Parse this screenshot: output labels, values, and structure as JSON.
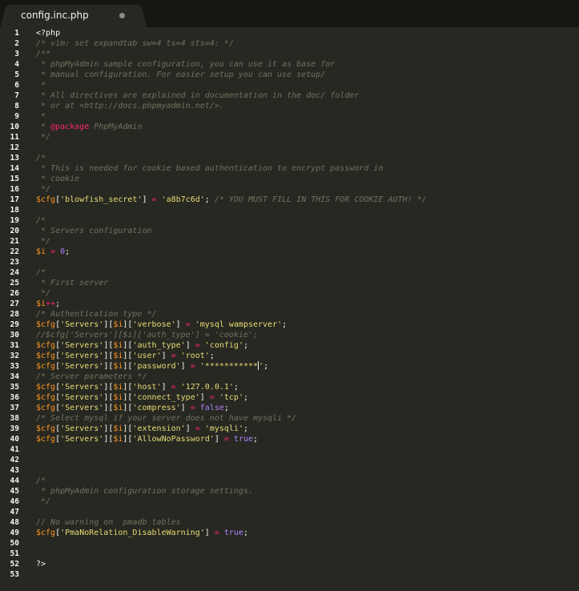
{
  "tab": {
    "title": "config.inc.php"
  },
  "colors": {
    "background": "#272822",
    "comment": "#75715e",
    "string": "#e6db74",
    "variable": "#fd971f",
    "number": "#ae81ff",
    "operator": "#f92672"
  },
  "lines": [
    {
      "n": "1",
      "t": [
        [
          "p",
          "<?php"
        ]
      ]
    },
    {
      "n": "2",
      "t": [
        [
          "c",
          "/* vim: set expandtab sw=4 ts=4 sts=4: */"
        ]
      ]
    },
    {
      "n": "3",
      "t": [
        [
          "c",
          "/**"
        ]
      ]
    },
    {
      "n": "4",
      "t": [
        [
          "c",
          " * phpMyAdmin sample configuration, you can use it as base for"
        ]
      ]
    },
    {
      "n": "5",
      "t": [
        [
          "c",
          " * manual configuration. For easier setup you can use setup/"
        ]
      ]
    },
    {
      "n": "6",
      "t": [
        [
          "c",
          " *"
        ]
      ]
    },
    {
      "n": "7",
      "t": [
        [
          "c",
          " * All directives are explained in documentation in the doc/ folder"
        ]
      ]
    },
    {
      "n": "8",
      "t": [
        [
          "c",
          " * or at <http://docs.phpmyadmin.net/>."
        ]
      ]
    },
    {
      "n": "9",
      "t": [
        [
          "c",
          " *"
        ]
      ]
    },
    {
      "n": "10",
      "t": [
        [
          "c",
          " * "
        ],
        [
          "tg",
          "@package"
        ],
        [
          "c",
          " PhpMyAdmin"
        ]
      ]
    },
    {
      "n": "11",
      "t": [
        [
          "c",
          " */"
        ]
      ]
    },
    {
      "n": "12",
      "t": []
    },
    {
      "n": "13",
      "t": [
        [
          "c",
          "/*"
        ]
      ]
    },
    {
      "n": "14",
      "t": [
        [
          "c",
          " * This is needed for cookie based authentication to encrypt password in"
        ]
      ]
    },
    {
      "n": "15",
      "t": [
        [
          "c",
          " * cookie"
        ]
      ]
    },
    {
      "n": "16",
      "t": [
        [
          "c",
          " */"
        ]
      ]
    },
    {
      "n": "17",
      "t": [
        [
          "v",
          "$cfg"
        ],
        [
          "p",
          "["
        ],
        [
          "s",
          "'blowfish_secret'"
        ],
        [
          "p",
          "] "
        ],
        [
          "o",
          "="
        ],
        [
          "p",
          " "
        ],
        [
          "s",
          "'a8b7c6d'"
        ],
        [
          "p",
          "; "
        ],
        [
          "c",
          "/* YOU MUST FILL IN THIS FOR COOKIE AUTH! */"
        ]
      ]
    },
    {
      "n": "18",
      "t": []
    },
    {
      "n": "19",
      "t": [
        [
          "c",
          "/*"
        ]
      ]
    },
    {
      "n": "20",
      "t": [
        [
          "c",
          " * Servers configuration"
        ]
      ]
    },
    {
      "n": "21",
      "t": [
        [
          "c",
          " */"
        ]
      ]
    },
    {
      "n": "22",
      "t": [
        [
          "v",
          "$i"
        ],
        [
          "p",
          " "
        ],
        [
          "o",
          "="
        ],
        [
          "p",
          " "
        ],
        [
          "n",
          "0"
        ],
        [
          "p",
          ";"
        ]
      ]
    },
    {
      "n": "23",
      "t": []
    },
    {
      "n": "24",
      "t": [
        [
          "c",
          "/*"
        ]
      ]
    },
    {
      "n": "25",
      "t": [
        [
          "c",
          " * First server"
        ]
      ]
    },
    {
      "n": "26",
      "t": [
        [
          "c",
          " */"
        ]
      ]
    },
    {
      "n": "27",
      "t": [
        [
          "v",
          "$i"
        ],
        [
          "o",
          "++"
        ],
        [
          "p",
          ";"
        ]
      ]
    },
    {
      "n": "28",
      "t": [
        [
          "c",
          "/* Authentication type */"
        ]
      ]
    },
    {
      "n": "29",
      "t": [
        [
          "v",
          "$cfg"
        ],
        [
          "p",
          "["
        ],
        [
          "s",
          "'Servers'"
        ],
        [
          "p",
          "]["
        ],
        [
          "v",
          "$i"
        ],
        [
          "p",
          "]["
        ],
        [
          "s",
          "'verbose'"
        ],
        [
          "p",
          "] "
        ],
        [
          "o",
          "="
        ],
        [
          "p",
          " "
        ],
        [
          "s",
          "'mysql wampserver'"
        ],
        [
          "p",
          ";"
        ]
      ]
    },
    {
      "n": "30",
      "t": [
        [
          "c",
          "//$cfg['Servers'][$i]['auth_type'] = 'cookie';"
        ]
      ]
    },
    {
      "n": "31",
      "t": [
        [
          "v",
          "$cfg"
        ],
        [
          "p",
          "["
        ],
        [
          "s",
          "'Servers'"
        ],
        [
          "p",
          "]["
        ],
        [
          "v",
          "$i"
        ],
        [
          "p",
          "]["
        ],
        [
          "s",
          "'auth_type'"
        ],
        [
          "p",
          "] "
        ],
        [
          "o",
          "="
        ],
        [
          "p",
          " "
        ],
        [
          "s",
          "'config'"
        ],
        [
          "p",
          ";"
        ]
      ]
    },
    {
      "n": "32",
      "t": [
        [
          "v",
          "$cfg"
        ],
        [
          "p",
          "["
        ],
        [
          "s",
          "'Servers'"
        ],
        [
          "p",
          "]["
        ],
        [
          "v",
          "$i"
        ],
        [
          "p",
          "]["
        ],
        [
          "s",
          "'user'"
        ],
        [
          "p",
          "] "
        ],
        [
          "o",
          "="
        ],
        [
          "p",
          " "
        ],
        [
          "s",
          "'root'"
        ],
        [
          "p",
          ";"
        ]
      ]
    },
    {
      "n": "33",
      "t": [
        [
          "v",
          "$cfg"
        ],
        [
          "p",
          "["
        ],
        [
          "s",
          "'Servers'"
        ],
        [
          "p",
          "]["
        ],
        [
          "v",
          "$i"
        ],
        [
          "p",
          "]["
        ],
        [
          "s",
          "'password'"
        ],
        [
          "p",
          "] "
        ],
        [
          "o",
          "="
        ],
        [
          "p",
          " "
        ],
        [
          "s",
          "'***********"
        ],
        [
          "caret",
          ""
        ],
        [
          "s",
          "'"
        ],
        [
          "p",
          ";"
        ]
      ]
    },
    {
      "n": "34",
      "t": [
        [
          "c",
          "/* Server parameters */"
        ]
      ]
    },
    {
      "n": "35",
      "t": [
        [
          "v",
          "$cfg"
        ],
        [
          "p",
          "["
        ],
        [
          "s",
          "'Servers'"
        ],
        [
          "p",
          "]["
        ],
        [
          "v",
          "$i"
        ],
        [
          "p",
          "]["
        ],
        [
          "s",
          "'host'"
        ],
        [
          "p",
          "] "
        ],
        [
          "o",
          "="
        ],
        [
          "p",
          " "
        ],
        [
          "s",
          "'127.0.0.1'"
        ],
        [
          "p",
          ";"
        ]
      ]
    },
    {
      "n": "36",
      "t": [
        [
          "v",
          "$cfg"
        ],
        [
          "p",
          "["
        ],
        [
          "s",
          "'Servers'"
        ],
        [
          "p",
          "]["
        ],
        [
          "v",
          "$i"
        ],
        [
          "p",
          "]["
        ],
        [
          "s",
          "'connect_type'"
        ],
        [
          "p",
          "] "
        ],
        [
          "o",
          "="
        ],
        [
          "p",
          " "
        ],
        [
          "s",
          "'tcp'"
        ],
        [
          "p",
          ";"
        ]
      ]
    },
    {
      "n": "37",
      "t": [
        [
          "v",
          "$cfg"
        ],
        [
          "p",
          "["
        ],
        [
          "s",
          "'Servers'"
        ],
        [
          "p",
          "]["
        ],
        [
          "v",
          "$i"
        ],
        [
          "p",
          "]["
        ],
        [
          "s",
          "'compress'"
        ],
        [
          "p",
          "] "
        ],
        [
          "o",
          "="
        ],
        [
          "p",
          " "
        ],
        [
          "k",
          "false"
        ],
        [
          "p",
          ";"
        ]
      ]
    },
    {
      "n": "38",
      "t": [
        [
          "c",
          "/* Select mysql if your server does not have mysqli */"
        ]
      ]
    },
    {
      "n": "39",
      "t": [
        [
          "v",
          "$cfg"
        ],
        [
          "p",
          "["
        ],
        [
          "s",
          "'Servers'"
        ],
        [
          "p",
          "]["
        ],
        [
          "v",
          "$i"
        ],
        [
          "p",
          "]["
        ],
        [
          "s",
          "'extension'"
        ],
        [
          "p",
          "] "
        ],
        [
          "o",
          "="
        ],
        [
          "p",
          " "
        ],
        [
          "s",
          "'mysqli'"
        ],
        [
          "p",
          ";"
        ]
      ]
    },
    {
      "n": "40",
      "t": [
        [
          "v",
          "$cfg"
        ],
        [
          "p",
          "["
        ],
        [
          "s",
          "'Servers'"
        ],
        [
          "p",
          "]["
        ],
        [
          "v",
          "$i"
        ],
        [
          "p",
          "]["
        ],
        [
          "s",
          "'AllowNoPassword'"
        ],
        [
          "p",
          "] "
        ],
        [
          "o",
          "="
        ],
        [
          "p",
          " "
        ],
        [
          "k",
          "true"
        ],
        [
          "p",
          ";"
        ]
      ]
    },
    {
      "n": "41",
      "t": []
    },
    {
      "n": "42",
      "t": []
    },
    {
      "n": "43",
      "t": []
    },
    {
      "n": "44",
      "t": [
        [
          "c",
          "/*"
        ]
      ]
    },
    {
      "n": "45",
      "t": [
        [
          "c",
          " * phpMyAdmin configuration storage settings."
        ]
      ]
    },
    {
      "n": "46",
      "t": [
        [
          "c",
          " */"
        ]
      ]
    },
    {
      "n": "47",
      "t": []
    },
    {
      "n": "48",
      "t": [
        [
          "c",
          "// No warning on  pmadb tables"
        ]
      ]
    },
    {
      "n": "49",
      "t": [
        [
          "v",
          "$cfg"
        ],
        [
          "p",
          "["
        ],
        [
          "s",
          "'PmaNoRelation_DisableWarning'"
        ],
        [
          "p",
          "] "
        ],
        [
          "o",
          "="
        ],
        [
          "p",
          " "
        ],
        [
          "k",
          "true"
        ],
        [
          "p",
          ";"
        ]
      ]
    },
    {
      "n": "50",
      "t": []
    },
    {
      "n": "51",
      "t": []
    },
    {
      "n": "52",
      "t": [
        [
          "p",
          "?>"
        ]
      ]
    },
    {
      "n": "53",
      "t": []
    }
  ]
}
